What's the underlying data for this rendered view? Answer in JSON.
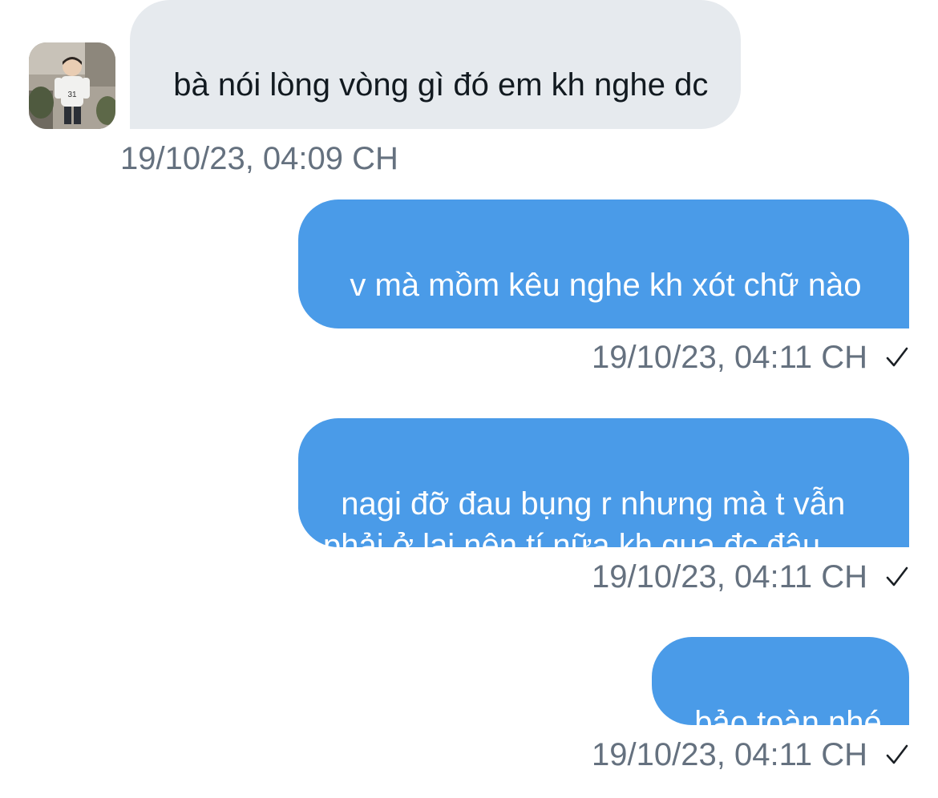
{
  "conversation": {
    "messages": [
      {
        "direction": "incoming",
        "text": "bà nói lòng vòng gì đó em kh nghe dc",
        "timestamp": "19/10/23, 04:09 CH"
      },
      {
        "direction": "outgoing",
        "text": " v mà mồm kêu nghe kh xót chữ nào",
        "timestamp": "19/10/23, 04:11 CH",
        "status_icon": "checkmark-icon"
      },
      {
        "direction": "outgoing",
        "text": "nagi đỡ đau bụng r nhưng mà t vẫn phải ở lại nên tí nữa kh qua đc đâu",
        "timestamp": "19/10/23, 04:11 CH",
        "status_icon": "checkmark-icon"
      },
      {
        "direction": "outgoing",
        "text": "bảo toàn nhé",
        "timestamp": "19/10/23, 04:11 CH",
        "status_icon": "checkmark-icon"
      }
    ]
  },
  "colors": {
    "incoming_bubble": "#e6eaee",
    "outgoing_bubble": "#4a9be8",
    "timestamp_text": "#65717f"
  },
  "avatar": {
    "icon": "profile-photo-avatar"
  }
}
